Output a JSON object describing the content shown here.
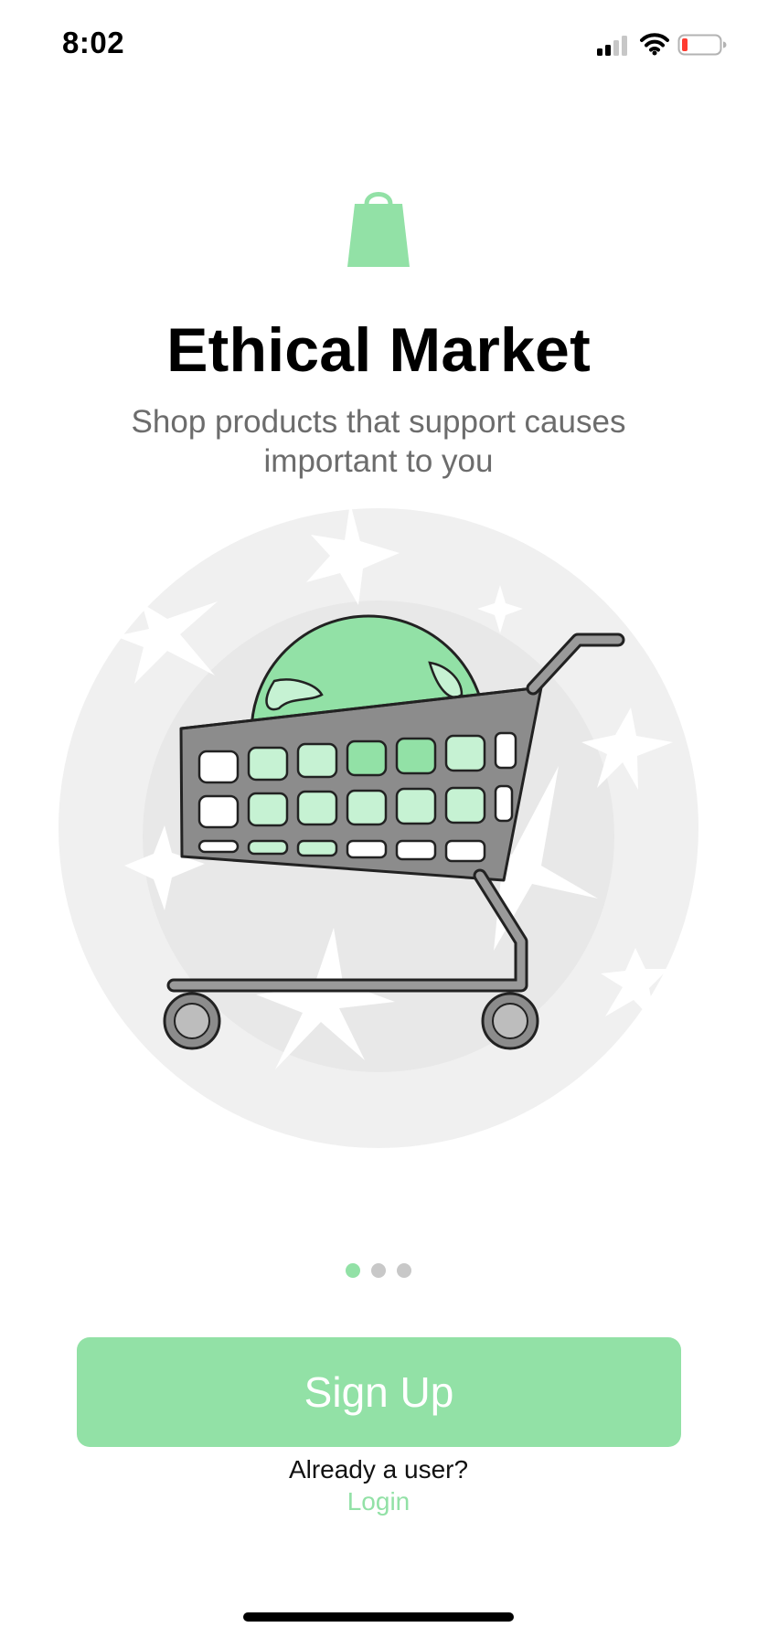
{
  "status_bar": {
    "time": "8:02",
    "icons": [
      "cellular-signal-icon",
      "wifi-icon",
      "battery-low-icon"
    ]
  },
  "app": {
    "logo_icon": "shopping-bag-icon",
    "title": "Ethical Market",
    "tagline": "Shop products that support causes important to you"
  },
  "hero": {
    "illustration": "shopping-cart-with-globe-illustration"
  },
  "pager": {
    "total_pages": 3,
    "active_index": 0
  },
  "actions": {
    "signup_label": "Sign Up",
    "already_user_text": "Already a user?",
    "login_label": "Login"
  },
  "colors": {
    "accent": "#92e1a6",
    "text_primary": "#000000",
    "text_secondary": "#6c6c6c",
    "inactive_dot": "#c8c8c8"
  }
}
